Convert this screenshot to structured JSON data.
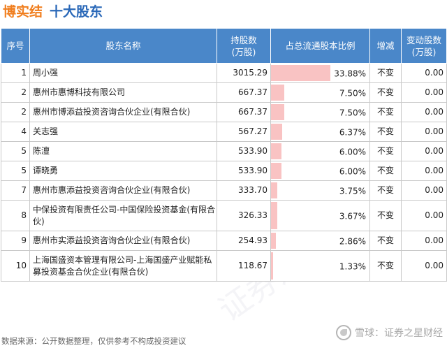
{
  "header": {
    "company": "博实结",
    "subtitle": "十大股东"
  },
  "table": {
    "columns": [
      "序号",
      "股东名称",
      "持股数\n(万股)",
      "占总流通股本比例",
      "增减",
      "变动股数\n(万股)"
    ],
    "rows": [
      {
        "rank": "1",
        "name": "周小强",
        "shares": "3015.29",
        "ratio_text": "33.88%",
        "ratio": 33.88,
        "change": "不变",
        "delta": "0.00"
      },
      {
        "rank": "2",
        "name": "惠州市惠博科技有限公司",
        "shares": "667.37",
        "ratio_text": "7.50%",
        "ratio": 7.5,
        "change": "不变",
        "delta": "0.00"
      },
      {
        "rank": "2",
        "name": "惠州市博添益投资咨询合伙企业(有限合伙)",
        "shares": "667.37",
        "ratio_text": "7.50%",
        "ratio": 7.5,
        "change": "不变",
        "delta": "0.00"
      },
      {
        "rank": "4",
        "name": "关志强",
        "shares": "567.27",
        "ratio_text": "6.37%",
        "ratio": 6.37,
        "change": "不变",
        "delta": "0.00"
      },
      {
        "rank": "5",
        "name": "陈澶",
        "shares": "533.90",
        "ratio_text": "6.00%",
        "ratio": 6.0,
        "change": "不变",
        "delta": "0.00"
      },
      {
        "rank": "5",
        "name": "谭晓勇",
        "shares": "533.90",
        "ratio_text": "6.00%",
        "ratio": 6.0,
        "change": "不变",
        "delta": "0.00"
      },
      {
        "rank": "7",
        "name": "惠州市惠添益投资咨询合伙企业(有限合伙)",
        "shares": "333.70",
        "ratio_text": "3.75%",
        "ratio": 3.75,
        "change": "不变",
        "delta": "0.00"
      },
      {
        "rank": "8",
        "name": "中保投资有限责任公司-中国保险投资基金(有限合伙)",
        "shares": "326.33",
        "ratio_text": "3.67%",
        "ratio": 3.67,
        "change": "不变",
        "delta": "0.00"
      },
      {
        "rank": "9",
        "name": "惠州市实添益投资咨询合伙企业(有限合伙)",
        "shares": "254.93",
        "ratio_text": "2.86%",
        "ratio": 2.86,
        "change": "不变",
        "delta": "0.00"
      },
      {
        "rank": "10",
        "name": "上海国盛资本管理有限公司-上海国盛产业赋能私募投资基金合伙企业(有限合伙)",
        "shares": "118.67",
        "ratio_text": "1.33%",
        "ratio": 1.33,
        "change": "不变",
        "delta": "0.00"
      }
    ]
  },
  "footer": {
    "source": "数据来源：公开数据整理，仅供参考不构成投资建议"
  },
  "branding": {
    "text": "雪球：证券之星财经",
    "icon": "snowball-logo-icon"
  },
  "watermark": {
    "text": "证券之星"
  },
  "colors": {
    "company": "#f07e1e",
    "subtitle": "#2a68b8",
    "header_bg": "#4a87c9",
    "bar": "#f9c3c3"
  }
}
